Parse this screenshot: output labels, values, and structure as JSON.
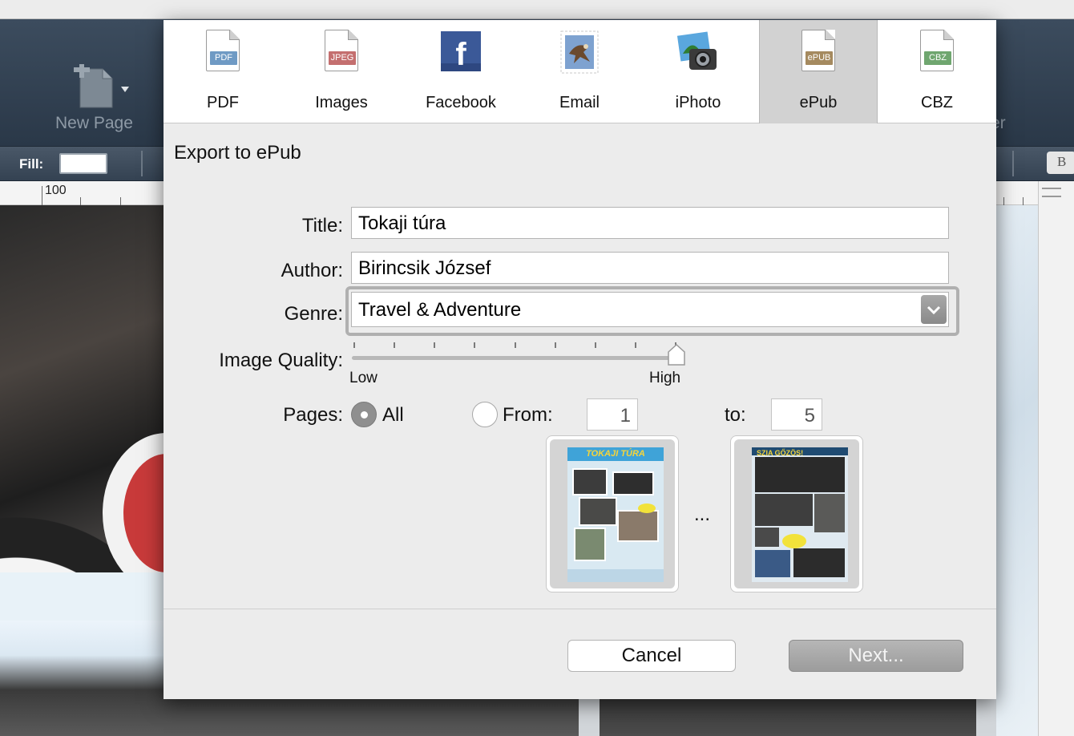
{
  "app": {
    "toolbar": {
      "new_page_label": "New Page",
      "partial_right_label": "er"
    },
    "formatbar": {
      "fill_label": "Fill:",
      "bold_label": "B"
    },
    "ruler": {
      "marker": "100"
    }
  },
  "dialog": {
    "tabs": [
      {
        "label": "PDF",
        "icon": "pdf-icon",
        "badge": "PDF",
        "badge_color": "#6f9ac4"
      },
      {
        "label": "Images",
        "icon": "jpeg-icon",
        "badge": "JPEG",
        "badge_color": "#c46f6f"
      },
      {
        "label": "Facebook",
        "icon": "facebook-icon",
        "badge": "f",
        "badge_color": "#3b5998"
      },
      {
        "label": "Email",
        "icon": "email-stamp-icon"
      },
      {
        "label": "iPhoto",
        "icon": "iphoto-icon"
      },
      {
        "label": "ePub",
        "icon": "epub-icon",
        "badge": "ePUB",
        "badge_color": "#a58a5f",
        "active": true
      },
      {
        "label": "CBZ",
        "icon": "cbz-icon",
        "badge": "CBZ",
        "badge_color": "#6fa66f"
      }
    ],
    "heading": "Export to ePub",
    "form": {
      "title_label": "Title:",
      "title_value": "Tokaji túra",
      "author_label": "Author:",
      "author_value": "Birincsik József",
      "genre_label": "Genre:",
      "genre_value": "Travel & Adventure",
      "quality_label": "Image Quality:",
      "quality_low": "Low",
      "quality_high": "High",
      "quality_level": 1.0,
      "pages_label": "Pages:",
      "pages_all": "All",
      "pages_from": "From:",
      "pages_from_value": "1",
      "pages_to": "to:",
      "pages_to_value": "5",
      "pages_selected": "all"
    },
    "thumbnails": {
      "first_title": "TOKAJI TÚRA",
      "last_title": "SZIA GŐZÖS!",
      "ellipsis": "..."
    },
    "buttons": {
      "cancel": "Cancel",
      "next": "Next..."
    }
  }
}
